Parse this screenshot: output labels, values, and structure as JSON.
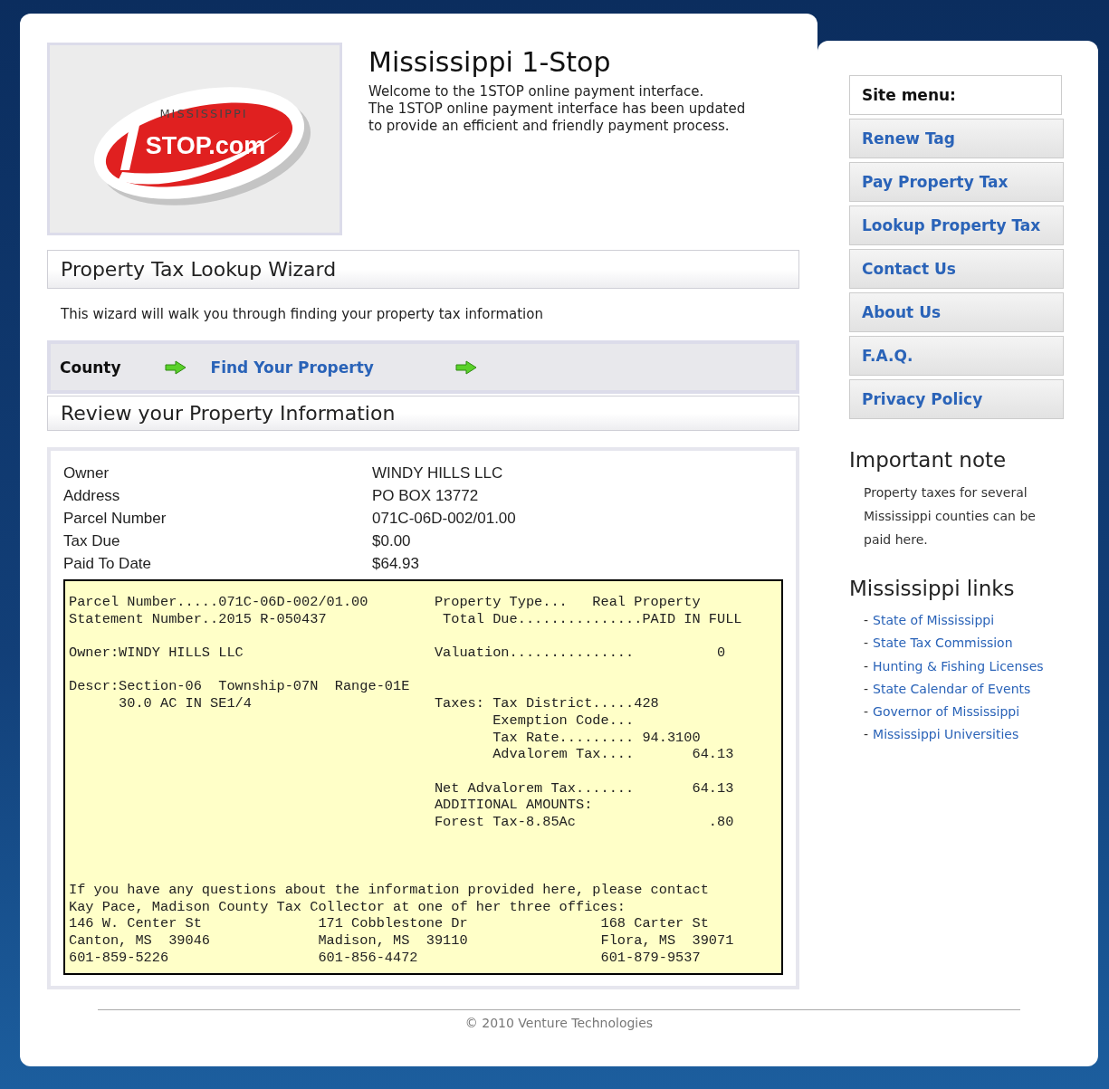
{
  "logo": {
    "top_text": "MISSISSIPPI",
    "main_text": "STOP.com"
  },
  "header": {
    "title": "Mississippi 1-Stop",
    "lines": [
      "Welcome to the 1STOP online payment interface.",
      "The 1STOP online payment interface has been updated",
      "to provide an efficient and friendly payment process."
    ]
  },
  "wizard": {
    "title": "Property Tax Lookup Wizard",
    "description": "This wizard will walk you through finding your property tax information",
    "steps": [
      {
        "label": "County",
        "kind": "text"
      },
      {
        "label": "Find Your Property",
        "kind": "link"
      }
    ],
    "section_title": "Review your Property Information"
  },
  "property": {
    "rows": [
      {
        "label": "Owner",
        "value": "WINDY HILLS LLC"
      },
      {
        "label": "Address",
        "value": "PO BOX 13772"
      },
      {
        "label": "Parcel Number",
        "value": "071C-06D-002/01.00"
      },
      {
        "label": "Tax Due",
        "value": "$0.00"
      },
      {
        "label": "Paid To Date",
        "value": "$64.93"
      }
    ]
  },
  "statement": {
    "sections": [
      {
        "kind": "detail",
        "lines": [
          "Parcel Number.....071C-06D-002/01.00        Property Type...   Real Property",
          "Statement Number..2015 R-050437              Total Due...............PAID IN FULL"
        ]
      },
      {
        "kind": "detail",
        "lines": [
          "Owner:WINDY HILLS LLC                       Valuation...............          0"
        ]
      },
      {
        "kind": "detail",
        "lines": [
          "Descr:Section-06  Township-07N  Range-01E",
          "      30.0 AC IN SE1/4                      Taxes: Tax District.....428",
          "                                                   Exemption Code...",
          "                                                   Tax Rate......... 94.3100",
          "                                                   Advalorem Tax....       64.13"
        ]
      },
      {
        "kind": "detail",
        "lines": [
          "                                            Net Advalorem Tax.......       64.13",
          "                                            ADDITIONAL AMOUNTS:",
          "                                            Forest Tax-8.85Ac                .80"
        ]
      },
      {
        "kind": "contact",
        "lines": [
          "If you have any questions about the information provided here, please contact",
          "Kay Pace, Madison County Tax Collector at one of her three offices:",
          "146 W. Center St              171 Cobblestone Dr                168 Carter St",
          "Canton, MS  39046             Madison, MS  39110                Flora, MS  39071",
          "601-859-5226                  601-856-4472                      601-879-9537"
        ]
      }
    ]
  },
  "site_menu": {
    "title": "Site menu:",
    "items": [
      "Renew Tag",
      "Pay Property Tax",
      "Lookup Property Tax",
      "Contact Us",
      "About Us",
      "F.A.Q.",
      "Privacy Policy"
    ]
  },
  "note": {
    "title": "Important note",
    "text": "Property taxes for several Mississippi counties can be paid here."
  },
  "links": {
    "title": "Mississippi links",
    "items": [
      {
        "bullet": "-",
        "label": "State of Mississippi"
      },
      {
        "bullet": "-",
        "label": "State Tax Commission"
      },
      {
        "bullet": "-",
        "label": "Hunting & Fishing Licenses"
      },
      {
        "bullet": "-",
        "label": "State Calendar of Events"
      },
      {
        "bullet": "-",
        "label": "Governor of Mississippi"
      },
      {
        "bullet": "-",
        "label": "Mississippi Universities"
      }
    ]
  },
  "footer": {
    "copyright": "© 2010 Venture Technologies"
  }
}
